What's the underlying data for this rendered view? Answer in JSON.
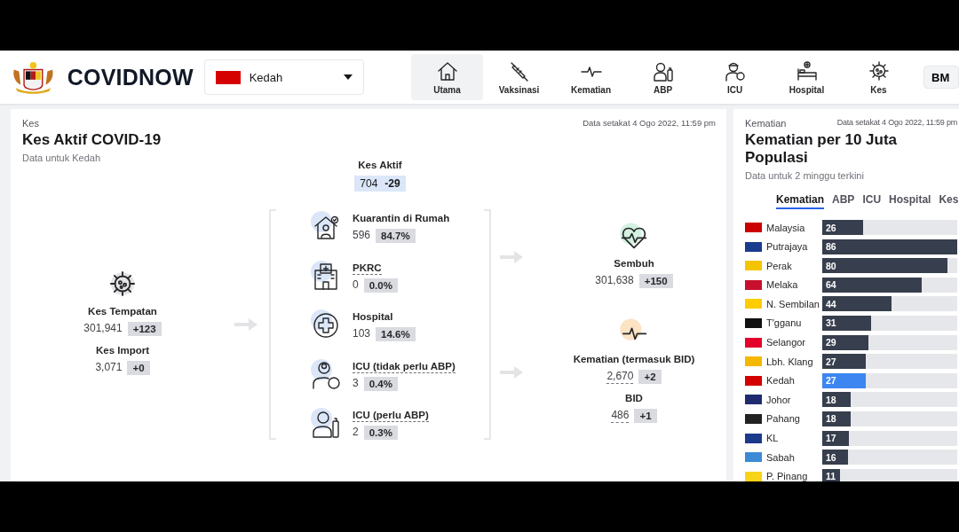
{
  "header": {
    "title": "COVIDNOW",
    "state_select": {
      "value": "Kedah",
      "color": "#d50000"
    },
    "nav": [
      {
        "label": "Utama",
        "selected": true
      },
      {
        "label": "Vaksinasi",
        "selected": false
      },
      {
        "label": "Kematian",
        "selected": false
      },
      {
        "label": "ABP",
        "selected": false
      },
      {
        "label": "ICU",
        "selected": false
      },
      {
        "label": "Hospital",
        "selected": false
      },
      {
        "label": "Kes",
        "selected": false
      }
    ],
    "language": "BM"
  },
  "active_cases": {
    "category": "Kes",
    "title": "Kes Aktif COVID-19",
    "subtitle": "Data untuk Kedah",
    "updated": "Data setakat 4 Ogo 2022, 11:59 pm",
    "sources": [
      {
        "label": "Kes Tempatan",
        "value": "301,941",
        "delta": "+123"
      },
      {
        "label": "Kes Import",
        "value": "3,071",
        "delta": "+0"
      }
    ],
    "total": {
      "label": "Kes Aktif",
      "value": "704",
      "delta": "-29"
    },
    "breakdown": [
      {
        "label": "Kuarantin di Rumah",
        "value": "596",
        "share": "84.7%",
        "dotted_underline": false
      },
      {
        "label": "PKRC",
        "value": "0",
        "share": "0.0%",
        "dotted_underline": true
      },
      {
        "label": "Hospital",
        "value": "103",
        "share": "14.6%",
        "dotted_underline": false
      },
      {
        "label": "ICU (tidak perlu ABP)",
        "value": "3",
        "share": "0.4%",
        "dotted_underline": true
      },
      {
        "label": "ICU (perlu ABP)",
        "value": "2",
        "share": "0.3%",
        "dotted_underline": true
      }
    ],
    "outcomes": [
      {
        "kind": "recovered",
        "items": [
          {
            "label": "Sembuh",
            "value": "301,638",
            "delta": "+150",
            "dotted_underline": false
          }
        ]
      },
      {
        "kind": "death",
        "items": [
          {
            "label": "Kematian (termasuk BID)",
            "value": "2,670",
            "delta": "+2",
            "dotted_underline": true
          },
          {
            "label": "BID",
            "value": "486",
            "delta": "+1",
            "dotted_underline": true
          }
        ]
      }
    ]
  },
  "deaths_panel": {
    "category": "Kematian",
    "updated": "Data setakat 4 Ogo 2022, 11:59 pm",
    "title": "Kematian per 10 Juta Populasi",
    "subtitle": "Data untuk 2 minggu terkini",
    "tabs": [
      {
        "label": "Kematian",
        "selected": true
      },
      {
        "label": "ABP",
        "selected": false
      },
      {
        "label": "ICU",
        "selected": false
      },
      {
        "label": "Hospital",
        "selected": false
      },
      {
        "label": "Kes",
        "selected": false
      }
    ],
    "rows": [
      {
        "name": "Malaysia",
        "value": "26",
        "level": 0.3,
        "selected": false,
        "color": "#cc0001"
      },
      {
        "name": "Putrajaya",
        "value": "86",
        "level": 1,
        "selected": false,
        "color": "#1a3c8f"
      },
      {
        "name": "Perak",
        "value": "80",
        "level": 0.93,
        "selected": false,
        "color": "#f5c400"
      },
      {
        "name": "Melaka",
        "value": "64",
        "level": 0.74,
        "selected": false,
        "color": "#c8102e"
      },
      {
        "name": "N. Sembilan",
        "value": "44",
        "level": 0.51,
        "selected": false,
        "color": "#ffcc00"
      },
      {
        "name": "T'gganu",
        "value": "31",
        "level": 0.36,
        "selected": false,
        "color": "#111111"
      },
      {
        "name": "Selangor",
        "value": "29",
        "level": 0.34,
        "selected": false,
        "color": "#e4002b"
      },
      {
        "name": "Lbh. Klang",
        "value": "27",
        "level": 0.32,
        "selected": false,
        "color": "#f5b800"
      },
      {
        "name": "Kedah",
        "value": "27",
        "level": 0.32,
        "selected": true,
        "color": "#d50000"
      },
      {
        "name": "Johor",
        "value": "18",
        "level": 0.21,
        "selected": false,
        "color": "#1f2a6f"
      },
      {
        "name": "Pahang",
        "value": "18",
        "level": 0.21,
        "selected": false,
        "color": "#222222"
      },
      {
        "name": "KL",
        "value": "17",
        "level": 0.2,
        "selected": false,
        "color": "#1b3a8a"
      },
      {
        "name": "Sabah",
        "value": "16",
        "level": 0.19,
        "selected": false,
        "color": "#3c8ad6"
      },
      {
        "name": "P. Pinang",
        "value": "11",
        "level": 0.13,
        "selected": false,
        "color": "#f7d417"
      }
    ]
  }
}
